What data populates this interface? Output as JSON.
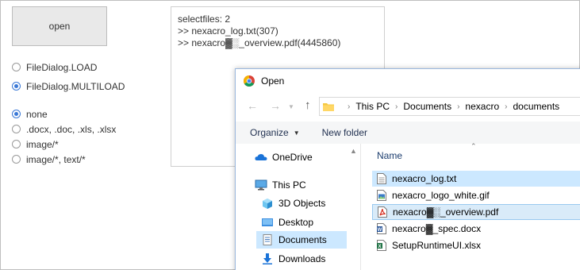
{
  "app": {
    "open_button": "open",
    "dialog_modes": [
      {
        "label": "FileDialog.LOAD",
        "selected": false
      },
      {
        "label": "FileDialog.MULTILOAD",
        "selected": true
      }
    ],
    "filters": [
      {
        "label": "none",
        "selected": true
      },
      {
        "label": ".docx, .doc, .xls, .xlsx",
        "selected": false
      },
      {
        "label": "image/*",
        "selected": false
      },
      {
        "label": "image/*, text/*",
        "selected": false
      }
    ],
    "log": {
      "line1": "selectfiles: 2",
      "line2": ">> nexacro_log.txt(307)",
      "line3": ">> nexacro▓░_overview.pdf(4445860)"
    }
  },
  "dialog": {
    "title": "Open",
    "breadcrumb": [
      "This PC",
      "Documents",
      "nexacro",
      "documents"
    ],
    "toolbar": {
      "organize": "Organize",
      "new_folder": "New folder"
    },
    "nav": [
      {
        "label": "OneDrive",
        "icon": "cloud-icon",
        "selected": false
      },
      {
        "label": "This PC",
        "icon": "computer-icon",
        "selected": false
      },
      {
        "label": "3D Objects",
        "icon": "cube-icon",
        "selected": false
      },
      {
        "label": "Desktop",
        "icon": "desktop-icon",
        "selected": false
      },
      {
        "label": "Documents",
        "icon": "documents-icon",
        "selected": true
      },
      {
        "label": "Downloads",
        "icon": "download-icon",
        "selected": false
      }
    ],
    "column_name": "Name",
    "files": [
      {
        "name": "nexacro_log.txt",
        "icon": "text-file-icon",
        "selected": true
      },
      {
        "name": "nexacro_logo_white.gif",
        "icon": "image-file-icon",
        "selected": false
      },
      {
        "name": "nexacro▓░_overview.pdf",
        "icon": "pdf-file-icon",
        "selected": true
      },
      {
        "name": "nexacro▓_spec.docx",
        "icon": "word-file-icon",
        "selected": false
      },
      {
        "name": "SetupRuntimeUI.xlsx",
        "icon": "excel-file-icon",
        "selected": false
      }
    ]
  }
}
